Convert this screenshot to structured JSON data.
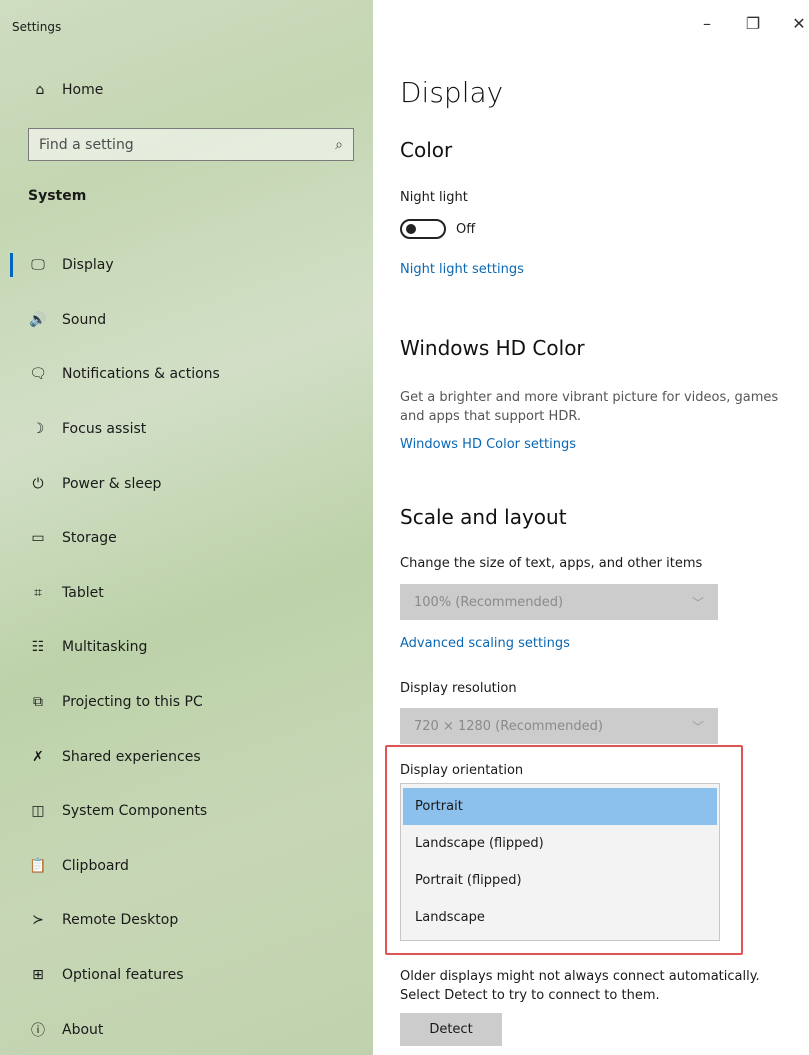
{
  "window": {
    "title": "Settings"
  },
  "sidebar": {
    "home_label": "Home",
    "search": {
      "placeholder": "Find a setting"
    },
    "section_label": "System",
    "items": [
      {
        "label": "Display",
        "icon": "monitor-icon",
        "glyph": "🖵",
        "active": true
      },
      {
        "label": "Sound",
        "icon": "speaker-icon",
        "glyph": "🔊"
      },
      {
        "label": "Notifications & actions",
        "icon": "notification-icon",
        "glyph": "🗨"
      },
      {
        "label": "Focus assist",
        "icon": "moon-icon",
        "glyph": "☽"
      },
      {
        "label": "Power & sleep",
        "icon": "power-icon",
        "glyph": "⏻"
      },
      {
        "label": "Storage",
        "icon": "storage-icon",
        "glyph": "▭"
      },
      {
        "label": "Tablet",
        "icon": "tablet-icon",
        "glyph": "⌗"
      },
      {
        "label": "Multitasking",
        "icon": "multitasking-icon",
        "glyph": "☷"
      },
      {
        "label": "Projecting to this PC",
        "icon": "projecting-icon",
        "glyph": "⧉"
      },
      {
        "label": "Shared experiences",
        "icon": "shared-icon",
        "glyph": "✗"
      },
      {
        "label": "System Components",
        "icon": "components-icon",
        "glyph": "◫"
      },
      {
        "label": "Clipboard",
        "icon": "clipboard-icon",
        "glyph": "📋"
      },
      {
        "label": "Remote Desktop",
        "icon": "remote-icon",
        "glyph": "≻"
      },
      {
        "label": "Optional features",
        "icon": "features-icon",
        "glyph": "⊞"
      },
      {
        "label": "About",
        "icon": "info-icon",
        "glyph": "ⓘ"
      }
    ]
  },
  "main": {
    "title": "Display",
    "color": {
      "heading": "Color",
      "night_light_label": "Night light",
      "night_light_state": "Off",
      "night_light_link": "Night light settings"
    },
    "hd": {
      "heading": "Windows HD Color",
      "description": "Get a brighter and more vibrant picture for videos, games and apps that support HDR.",
      "link": "Windows HD Color settings"
    },
    "scale": {
      "heading": "Scale and layout",
      "size_label": "Change the size of text, apps, and other items",
      "size_value": "100% (Recommended)",
      "advanced_link": "Advanced scaling settings",
      "resolution_label": "Display resolution",
      "resolution_value": "720 × 1280 (Recommended)",
      "orientation_label": "Display orientation",
      "orientation_options": [
        "Portrait",
        "Landscape (flipped)",
        "Portrait (flipped)",
        "Landscape"
      ],
      "orientation_selected": "Portrait"
    },
    "detect": {
      "description": "Older displays might not always connect automatically. Select Detect to try to connect to them.",
      "button": "Detect"
    }
  },
  "colors": {
    "accent": "#0067c0",
    "link": "#0a68b4",
    "highlight": "#e25353",
    "selected": "#8cc0ed"
  }
}
